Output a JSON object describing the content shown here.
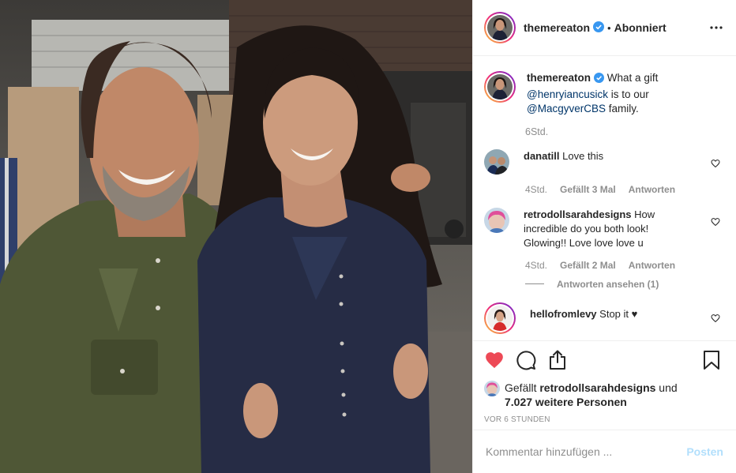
{
  "post": {
    "author": "themereaton",
    "follow_state": "Abonniert",
    "separator": "•",
    "caption": {
      "username": "themereaton",
      "text_before": "What a gift",
      "mention_1": "@henryiancusick",
      "text_middle": "is to our",
      "mention_2": "@MacgyverCBS",
      "text_after": "family.",
      "time": "6Std."
    },
    "comments": [
      {
        "username": "danatill",
        "text": "Love this",
        "time": "4Std.",
        "likes": "Gefällt 3 Mal",
        "reply": "Antworten"
      },
      {
        "username": "retrodollsarahdesigns",
        "text": "How incredible do you both look! Glowing!! Love love love u",
        "time": "4Std.",
        "likes": "Gefällt 2 Mal",
        "reply": "Antworten",
        "view_replies": "Antworten ansehen (1)"
      },
      {
        "username": "hellofromlevy",
        "text": "Stop it ♥"
      }
    ],
    "likes": {
      "prefix": "Gefällt",
      "user": "retrodollsarahdesigns",
      "and": "und",
      "others": "7.027 weitere Personen"
    },
    "timestamp": "VOR 6 STUNDEN",
    "comment_input": {
      "placeholder": "Kommentar hinzufügen ...",
      "value": ""
    },
    "post_button": "Posten"
  },
  "icons": {
    "verified": "verified-badge-icon",
    "more": "more-options-icon",
    "like": "heart-icon",
    "comment": "comment-bubble-icon",
    "share": "share-icon",
    "save": "bookmark-icon"
  },
  "colors": {
    "liked_heart": "#ed4956",
    "verified": "#3897f0",
    "mention": "#003569",
    "muted": "#8e8e8e",
    "post_button_disabled": "#b2dffc"
  }
}
